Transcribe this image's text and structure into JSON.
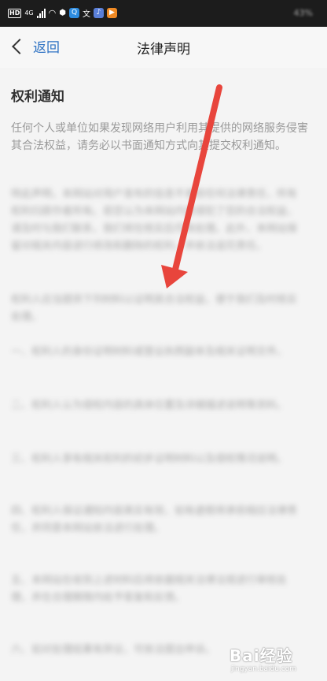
{
  "status_bar": {
    "hd": "HD",
    "network": "4G",
    "battery": "43%"
  },
  "header": {
    "back_label": "返回",
    "title": "法律声明"
  },
  "content": {
    "section_title": "权利通知",
    "paragraph_1": "任何个人或单位如果发现网络用户利用其提供的网络服务侵害其合法权益，请务必以书面通知方式向其提交权利通知。",
    "blurred": [
      "特此声明，本网站对用户发布的信息不承担任何法律责任，所有权利归原作者所有。若您认为本网站内容侵犯了您的合法权益，请及时与我们联系，我们将在核实后尽快处理。此外，本网站保留对相关内容进行修改和删除的权利，并依法追究责任。",
      "权利人应当提供下列材料以证明其合法权益，便于我们及时核实处理。",
      "一、权利人的身份证明材料或营业执照副本及相关证明文件。",
      "二、权利人认为侵权内容的具体位置及详细描述说明等资料。",
      "三、权利人享有相关权利的初步证明材料以及侵权情况说明。",
      "四、权利人保证通知内容真实有效，如有虚假将承担相应法律责任，并同意本网站依法进行处理。",
      "五、本网站在收到上述材料后将依据相关法律法规进行审核处理，并在合理期限内给予答复和反馈。",
      "六、如对处理结果有异议，可依法提出申诉。"
    ]
  },
  "watermark": {
    "brand": "Bai经验",
    "url": "jingyan.baidu.com"
  },
  "colors": {
    "link": "#2f73c4",
    "arrow": "#e8453c"
  }
}
